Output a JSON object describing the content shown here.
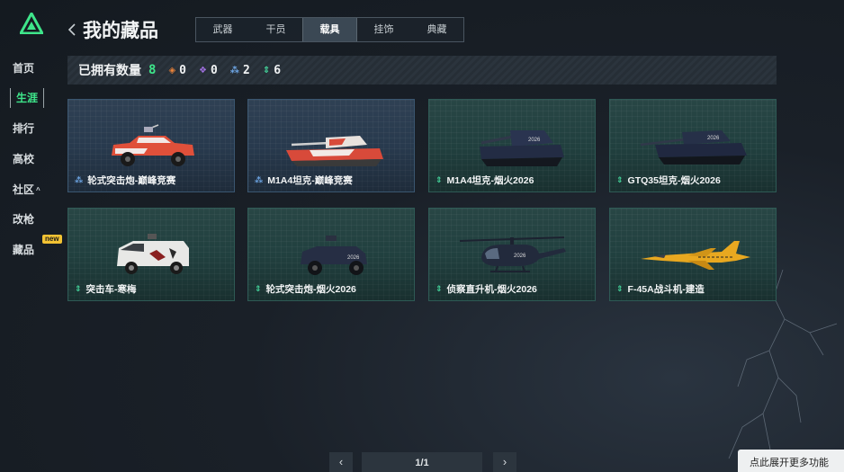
{
  "app": {
    "logo_icon": "triangle-logo-icon",
    "accent": "#3ee58a"
  },
  "sidebar": {
    "items": [
      {
        "label": "首页",
        "active": false
      },
      {
        "label": "生涯",
        "active": true
      },
      {
        "label": "排行",
        "active": false
      },
      {
        "label": "高校",
        "active": false
      },
      {
        "label": "社区",
        "active": false,
        "caret": "^"
      },
      {
        "label": "改枪",
        "active": false
      },
      {
        "label": "藏品",
        "active": false,
        "badge": "new"
      }
    ]
  },
  "header": {
    "title": "我的藏品",
    "back_icon": "chevron-left-icon"
  },
  "tabs": [
    {
      "label": "武器",
      "active": false
    },
    {
      "label": "干员",
      "active": false
    },
    {
      "label": "载具",
      "active": true
    },
    {
      "label": "挂饰",
      "active": false
    },
    {
      "label": "典藏",
      "active": false
    }
  ],
  "stats": {
    "label": "已拥有数量",
    "total": "8",
    "groups": [
      {
        "icon": "orange-diamond-icon",
        "color": "#e8823a",
        "value": "0"
      },
      {
        "icon": "purple-diamond-icon",
        "color": "#a070e0",
        "value": "0"
      },
      {
        "icon": "blue-rank-icon",
        "color": "#6fa8e8",
        "value": "2"
      },
      {
        "icon": "green-rank-icon",
        "color": "#44d39a",
        "value": "6"
      }
    ]
  },
  "cards": [
    {
      "name": "轮式突击炮-巅峰竞赛",
      "rarity": "blue",
      "vehicle": "armored-car-icon"
    },
    {
      "name": "M1A4坦克-巅峰竞赛",
      "rarity": "blue",
      "vehicle": "tank-icon"
    },
    {
      "name": "M1A4坦克-烟火2026",
      "rarity": "green",
      "vehicle": "tank-icon"
    },
    {
      "name": "GTQ35坦克-烟火2026",
      "rarity": "green",
      "vehicle": "tank-icon"
    },
    {
      "name": "突击车-寒梅",
      "rarity": "green",
      "vehicle": "armored-truck-icon"
    },
    {
      "name": "轮式突击炮-烟火2026",
      "rarity": "green",
      "vehicle": "armored-car-icon"
    },
    {
      "name": "侦察直升机-烟火2026",
      "rarity": "green",
      "vehicle": "helicopter-icon"
    },
    {
      "name": "F-45A战斗机-建造",
      "rarity": "green",
      "vehicle": "jet-fighter-icon"
    }
  ],
  "pagination": {
    "page": "1/1",
    "prev_icon": "chevron-left-icon",
    "next_icon": "chevron-right-icon"
  },
  "more_button": {
    "label": "点此展开更多功能"
  }
}
